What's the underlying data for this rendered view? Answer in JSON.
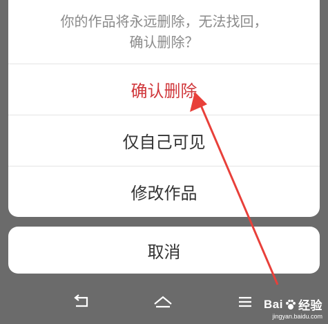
{
  "dialog": {
    "prompt_line1": "你的作品将永远删除，无法找回，",
    "prompt_line2": "确认删除？",
    "options": [
      {
        "label": "确认删除",
        "style": "danger"
      },
      {
        "label": "仅自己可见",
        "style": "normal"
      },
      {
        "label": "修改作品",
        "style": "normal"
      }
    ],
    "cancel_label": "取消"
  },
  "navbar": {
    "back_icon": "back-icon",
    "home_icon": "home-icon",
    "menu_icon": "menu-icon"
  },
  "watermark": {
    "brand": "Bai",
    "brand_suffix": "经验",
    "url": "jingyan.baidu.com"
  },
  "colors": {
    "danger": "#d0383c",
    "annotation_arrow": "#e8403a"
  }
}
